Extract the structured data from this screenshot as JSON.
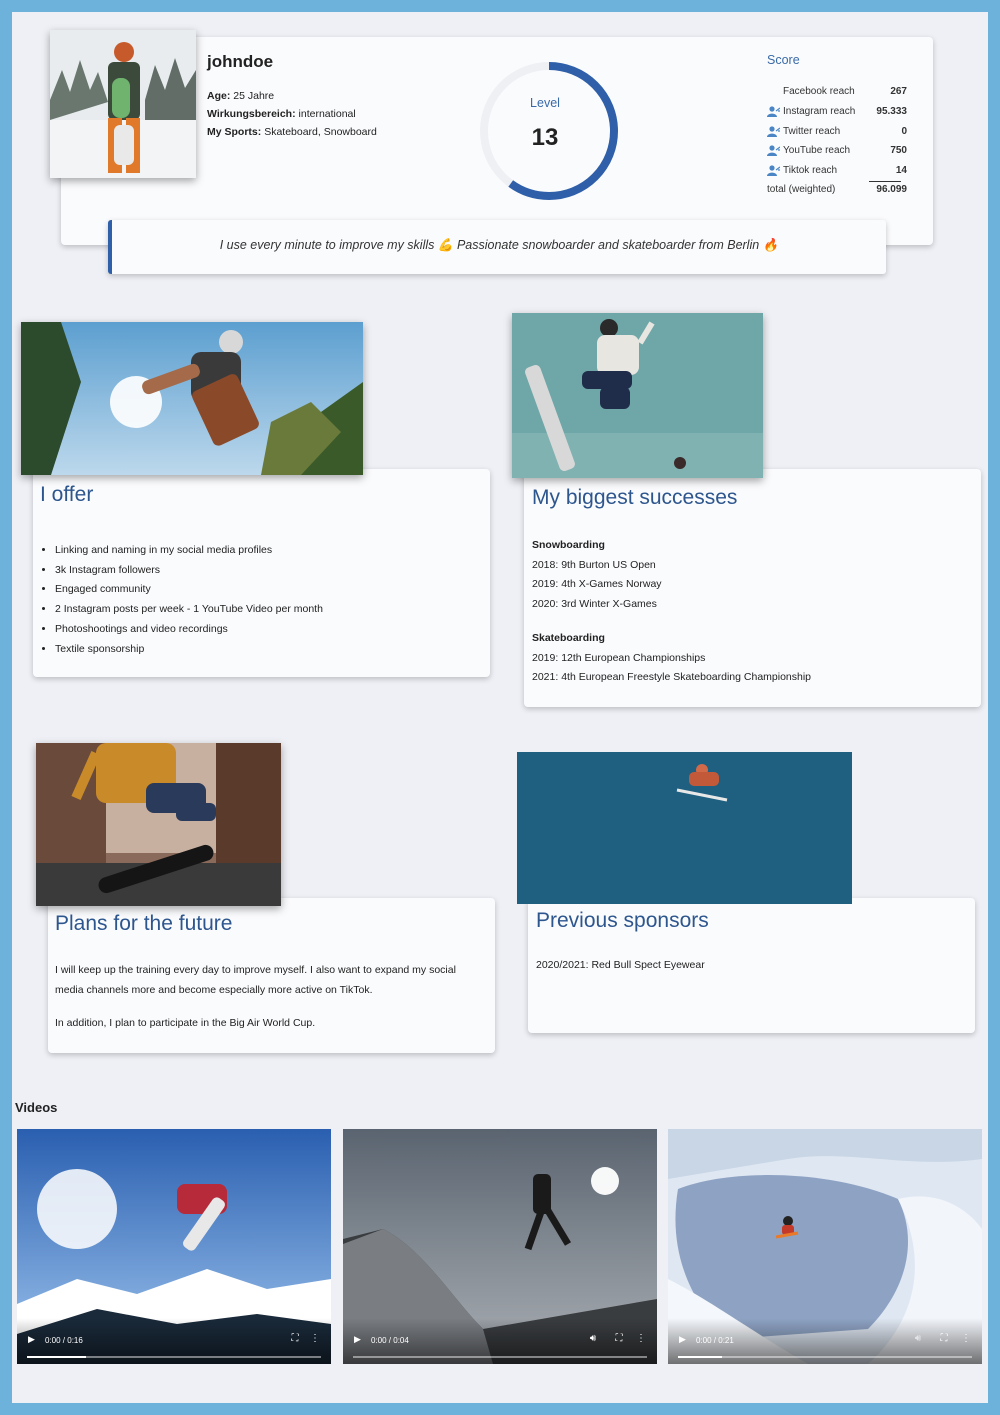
{
  "profile": {
    "username": "johndoe",
    "age_label": "Age:",
    "age_value": "25 Jahre",
    "area_label": "Wirkungsbereich:",
    "area_value": "international",
    "sports_label": "My Sports:",
    "sports_value": "Skateboard, Snowboard"
  },
  "level": {
    "label": "Level",
    "value": "13",
    "progress": 0.6
  },
  "score": {
    "title": "Score",
    "rows": [
      {
        "label": "Facebook reach",
        "value": "267",
        "icon": ""
      },
      {
        "label": "Instagram reach",
        "value": "95.333",
        "icon": "user-icon"
      },
      {
        "label": "Twitter reach",
        "value": "0",
        "icon": "user-icon"
      },
      {
        "label": "YouTube reach",
        "value": "750",
        "icon": "user-icon"
      },
      {
        "label": "Tiktok reach",
        "value": "14",
        "icon": "user-icon"
      }
    ],
    "total_label": "total (weighted)",
    "total_value": "96.099"
  },
  "quote": {
    "text1": "I use every minute to improve my skills",
    "text2": "Passionate snowboarder and skateboarder from Berlin",
    "emoji1": "💪",
    "emoji2": "🔥"
  },
  "offer": {
    "title": "I offer",
    "items": [
      "Linking and naming in my social media profiles",
      "3k Instagram followers",
      "Engaged community",
      "2 Instagram posts per week - 1 YouTube Video per month",
      "Photoshootings and video recordings",
      "Textile sponsorship"
    ]
  },
  "successes": {
    "title": "My biggest successes",
    "groups": [
      {
        "heading": "Snowboarding",
        "lines": [
          "2018: 9th Burton US Open",
          "2019: 4th X-Games Norway",
          "2020: 3rd Winter X-Games"
        ]
      },
      {
        "heading": "Skateboarding",
        "lines": [
          "2019: 12th European Championships",
          "2021: 4th European Freestyle Skateboarding Championship"
        ]
      }
    ]
  },
  "plans": {
    "title": "Plans for the future",
    "p1": "I will keep up the training every day to improve myself. I also want to expand my social media channels more and become especially more active on TikTok.",
    "p2": "In addition, I plan to participate in the Big Air World Cup."
  },
  "sponsors": {
    "title": "Previous sponsors",
    "line": "2020/2021: Red Bull Spect Eyewear"
  },
  "videos": {
    "heading": "Videos",
    "items": [
      {
        "time": "0:00 / 0:16",
        "progress": 0.2
      },
      {
        "time": "0:00 / 0:04",
        "progress": 0.0
      },
      {
        "time": "0:00 / 0:21",
        "progress": 0.15
      }
    ]
  },
  "colors": {
    "accent": "#2e5fa8",
    "frame": "#6cb2da",
    "page_bg": "#eef0f6"
  }
}
